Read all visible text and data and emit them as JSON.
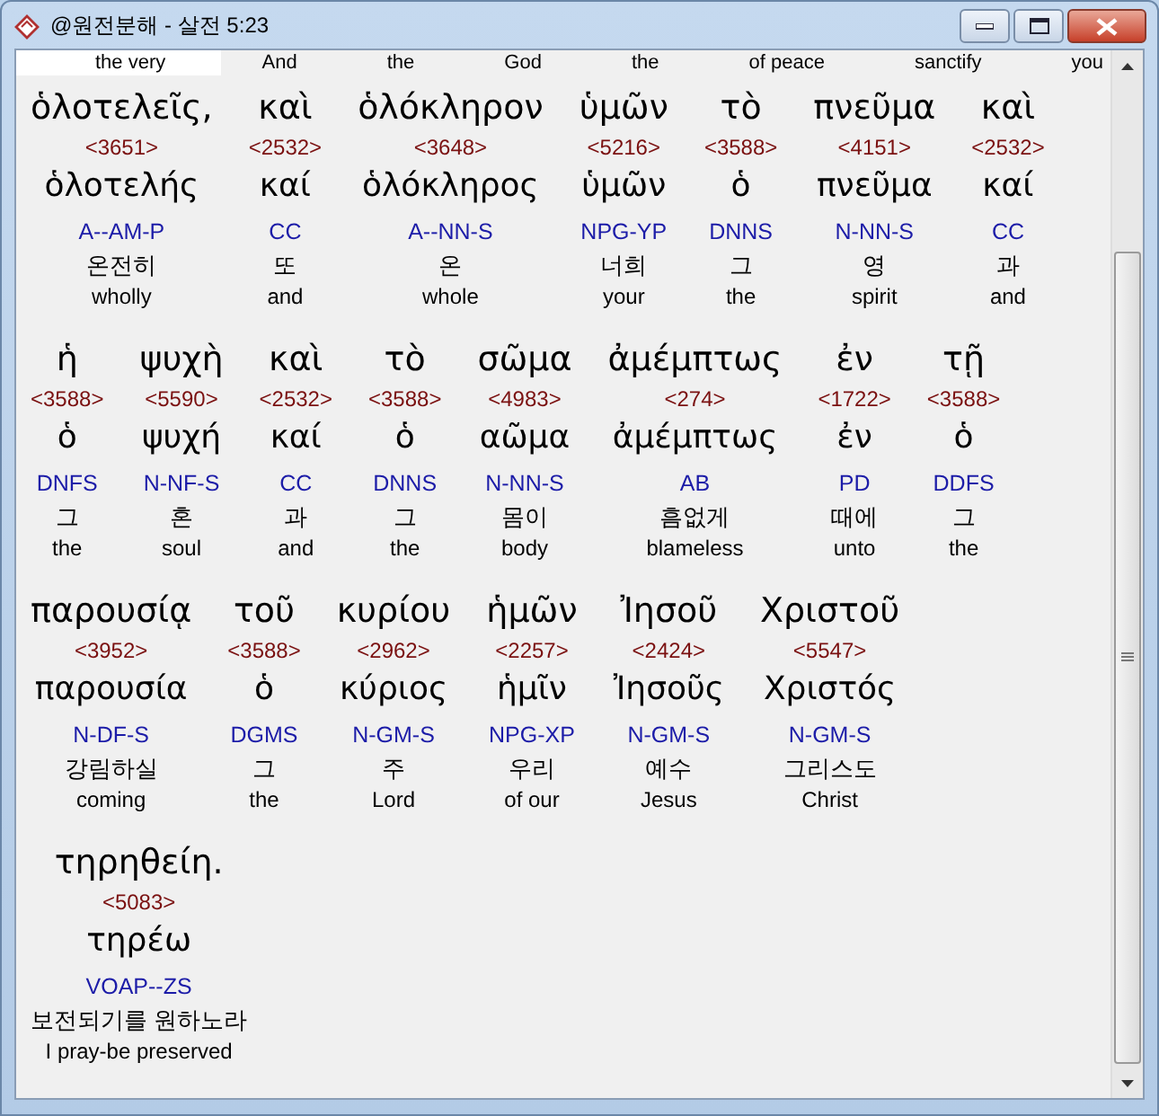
{
  "window": {
    "title": "@원전분해 - 살전 5:23"
  },
  "previous_row": [
    {
      "text": "the very",
      "highlighted": true
    },
    {
      "text": "And",
      "highlighted": false
    },
    {
      "text": "the",
      "highlighted": false
    },
    {
      "text": "God",
      "highlighted": false
    },
    {
      "text": "the",
      "highlighted": false
    },
    {
      "text": "of peace",
      "highlighted": false
    },
    {
      "text": "sanctify",
      "highlighted": false
    },
    {
      "text": "you",
      "highlighted": false
    }
  ],
  "lines": [
    [
      {
        "greek": "ὁλοτελεῖς,",
        "strong": "<3651>",
        "lemma": "ὁλοτελής",
        "morph": "A--AM-P",
        "korean": "온전히",
        "english": "wholly"
      },
      {
        "greek": "καὶ",
        "strong": "<2532>",
        "lemma": "καί",
        "morph": "CC",
        "korean": "또",
        "english": "and"
      },
      {
        "greek": "ὁλόκληρον",
        "strong": "<3648>",
        "lemma": "ὁλόκληρος",
        "morph": "A--NN-S",
        "korean": "온",
        "english": "whole"
      },
      {
        "greek": "ὑμῶν",
        "strong": "<5216>",
        "lemma": "ὑμῶν",
        "morph": "NPG-YP",
        "korean": "너희",
        "english": "your"
      },
      {
        "greek": "τὸ",
        "strong": "<3588>",
        "lemma": "ὁ",
        "morph": "DNNS",
        "korean": "그",
        "english": "the"
      },
      {
        "greek": "πνεῦμα",
        "strong": "<4151>",
        "lemma": "πνεῦμα",
        "morph": "N-NN-S",
        "korean": "영",
        "english": "spirit"
      },
      {
        "greek": "καὶ",
        "strong": "<2532>",
        "lemma": "καί",
        "morph": "CC",
        "korean": "과",
        "english": "and"
      }
    ],
    [
      {
        "greek": "ἡ",
        "strong": "<3588>",
        "lemma": "ὁ",
        "morph": "DNFS",
        "korean": "그",
        "english": "the"
      },
      {
        "greek": "ψυχὴ",
        "strong": "<5590>",
        "lemma": "ψυχή",
        "morph": "N-NF-S",
        "korean": "혼",
        "english": "soul"
      },
      {
        "greek": "καὶ",
        "strong": "<2532>",
        "lemma": "καί",
        "morph": "CC",
        "korean": "과",
        "english": "and"
      },
      {
        "greek": "τὸ",
        "strong": "<3588>",
        "lemma": "ὁ",
        "morph": "DNNS",
        "korean": "그",
        "english": "the"
      },
      {
        "greek": "σῶμα",
        "strong": "<4983>",
        "lemma": "αῶμα",
        "morph": "N-NN-S",
        "korean": "몸이",
        "english": "body"
      },
      {
        "greek": "ἀμέμπτως",
        "strong": "<274>",
        "lemma": "ἀμέμπτως",
        "morph": "AB",
        "korean": "흠없게",
        "english": "blameless"
      },
      {
        "greek": "ἐν",
        "strong": "<1722>",
        "lemma": "ἐν",
        "morph": "PD",
        "korean": "때에",
        "english": "unto"
      },
      {
        "greek": "τῇ",
        "strong": "<3588>",
        "lemma": "ὁ",
        "morph": "DDFS",
        "korean": "그",
        "english": "the"
      }
    ],
    [
      {
        "greek": "παρουσίᾳ",
        "strong": "<3952>",
        "lemma": "παρουσία",
        "morph": "N-DF-S",
        "korean": "강림하실",
        "english": "coming"
      },
      {
        "greek": "τοῦ",
        "strong": "<3588>",
        "lemma": "ὁ",
        "morph": "DGMS",
        "korean": "그",
        "english": "the"
      },
      {
        "greek": "κυρίου",
        "strong": "<2962>",
        "lemma": "κύριος",
        "morph": "N-GM-S",
        "korean": "주",
        "english": "Lord"
      },
      {
        "greek": "ἡμῶν",
        "strong": "<2257>",
        "lemma": "ἡμῖν",
        "morph": "NPG-XP",
        "korean": "우리",
        "english": "of our"
      },
      {
        "greek": "Ἰησοῦ",
        "strong": "<2424>",
        "lemma": "Ἰησοῦς",
        "morph": "N-GM-S",
        "korean": "예수",
        "english": "Jesus"
      },
      {
        "greek": "Χριστοῦ",
        "strong": "<5547>",
        "lemma": "Χριστός",
        "morph": "N-GM-S",
        "korean": "그리스도",
        "english": "Christ"
      }
    ],
    [
      {
        "greek": "τηρηθείη.",
        "strong": "<5083>",
        "lemma": "τηρέω",
        "morph": "VOAP--ZS",
        "korean": "보전되기를 원하노라",
        "english": "I pray-be preserved"
      }
    ]
  ]
}
